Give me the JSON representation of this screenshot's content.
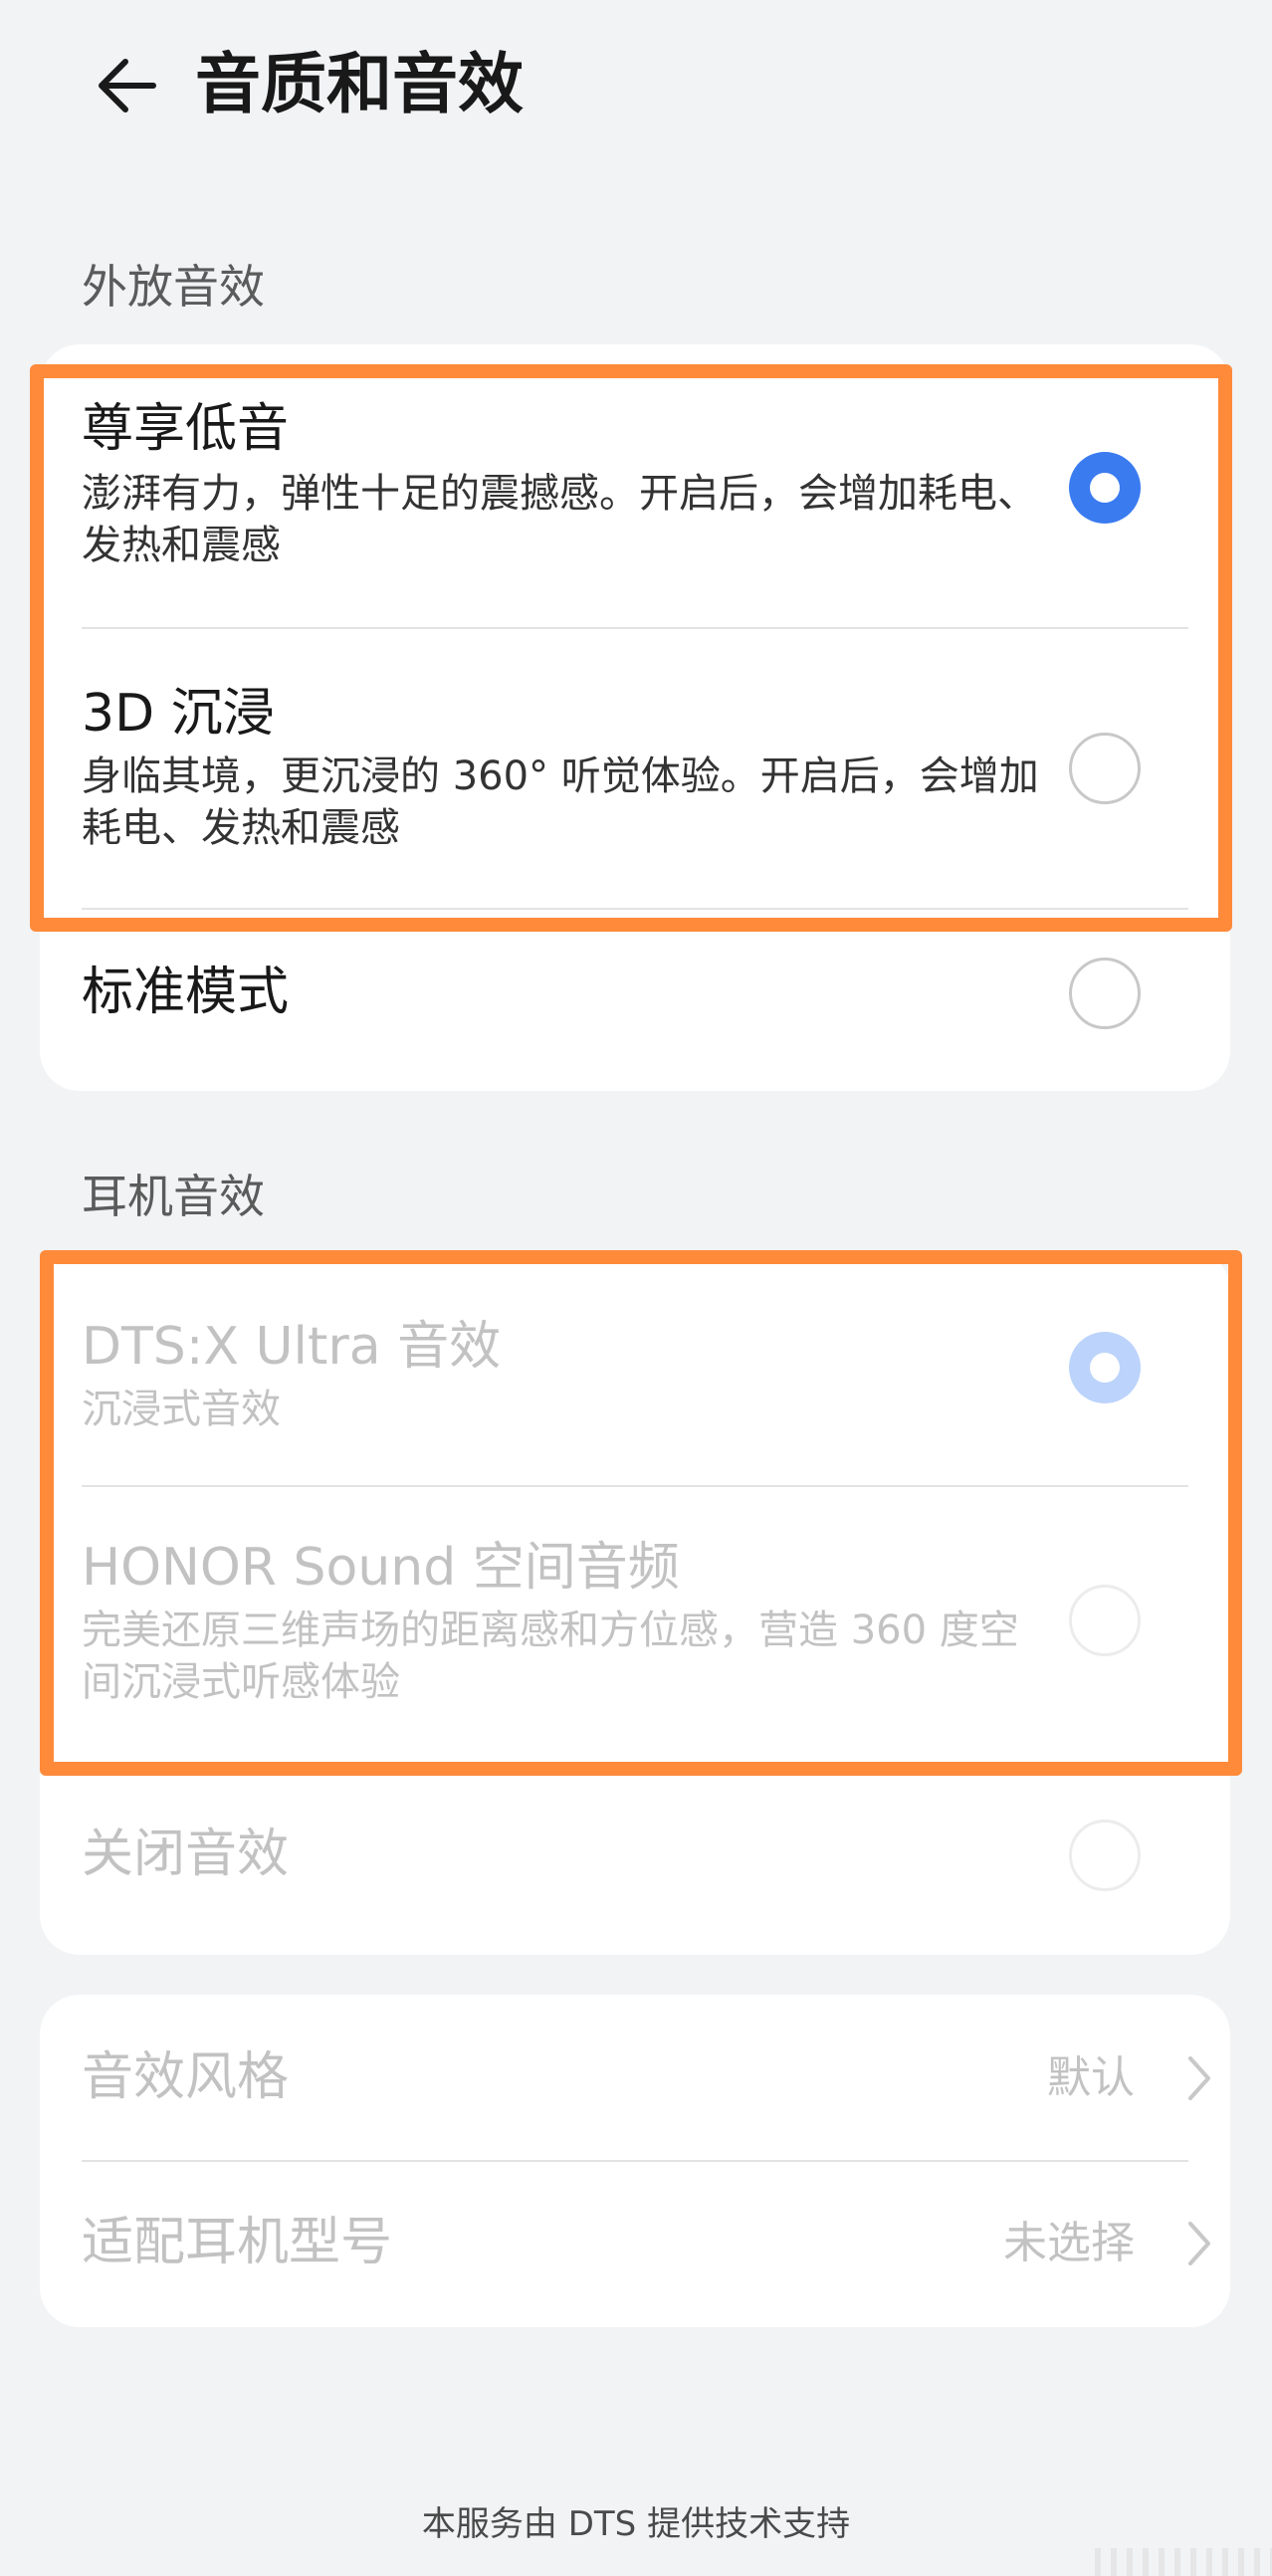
{
  "header": {
    "title": "音质和音效",
    "back_icon": "arrow-left-icon"
  },
  "speaker_section": {
    "label": "外放音效",
    "items": [
      {
        "title": "尊享低音",
        "description": "澎湃有力，弹性十足的震撼感。开启后，会增加耗电、发热和震感",
        "selected": true
      },
      {
        "title": "3D 沉浸",
        "description": "身临其境，更沉浸的 360° 听觉体验。开启后，会增加耗电、发热和震感",
        "selected": false
      },
      {
        "title": "标准模式",
        "selected": false
      }
    ]
  },
  "headphone_section": {
    "label": "耳机音效",
    "items": [
      {
        "title": "DTS:X Ultra 音效",
        "description": "沉浸式音效",
        "selected": true,
        "disabled": true
      },
      {
        "title": "HONOR Sound 空间音频",
        "description": "完美还原三维声场的距离感和方位感，营造 360 度空间沉浸式听感体验",
        "selected": false,
        "disabled": true
      },
      {
        "title": "关闭音效",
        "selected": false,
        "disabled": true
      }
    ]
  },
  "settings": {
    "items": [
      {
        "title": "音效风格",
        "value": "默认"
      },
      {
        "title": "适配耳机型号",
        "value": "未选择"
      }
    ]
  },
  "footer": {
    "note": "本服务由 DTS 提供技术支持"
  },
  "colors": {
    "accent": "#3a7bf0",
    "highlight": "#ff8a3a",
    "background": "#f1f3f5"
  }
}
